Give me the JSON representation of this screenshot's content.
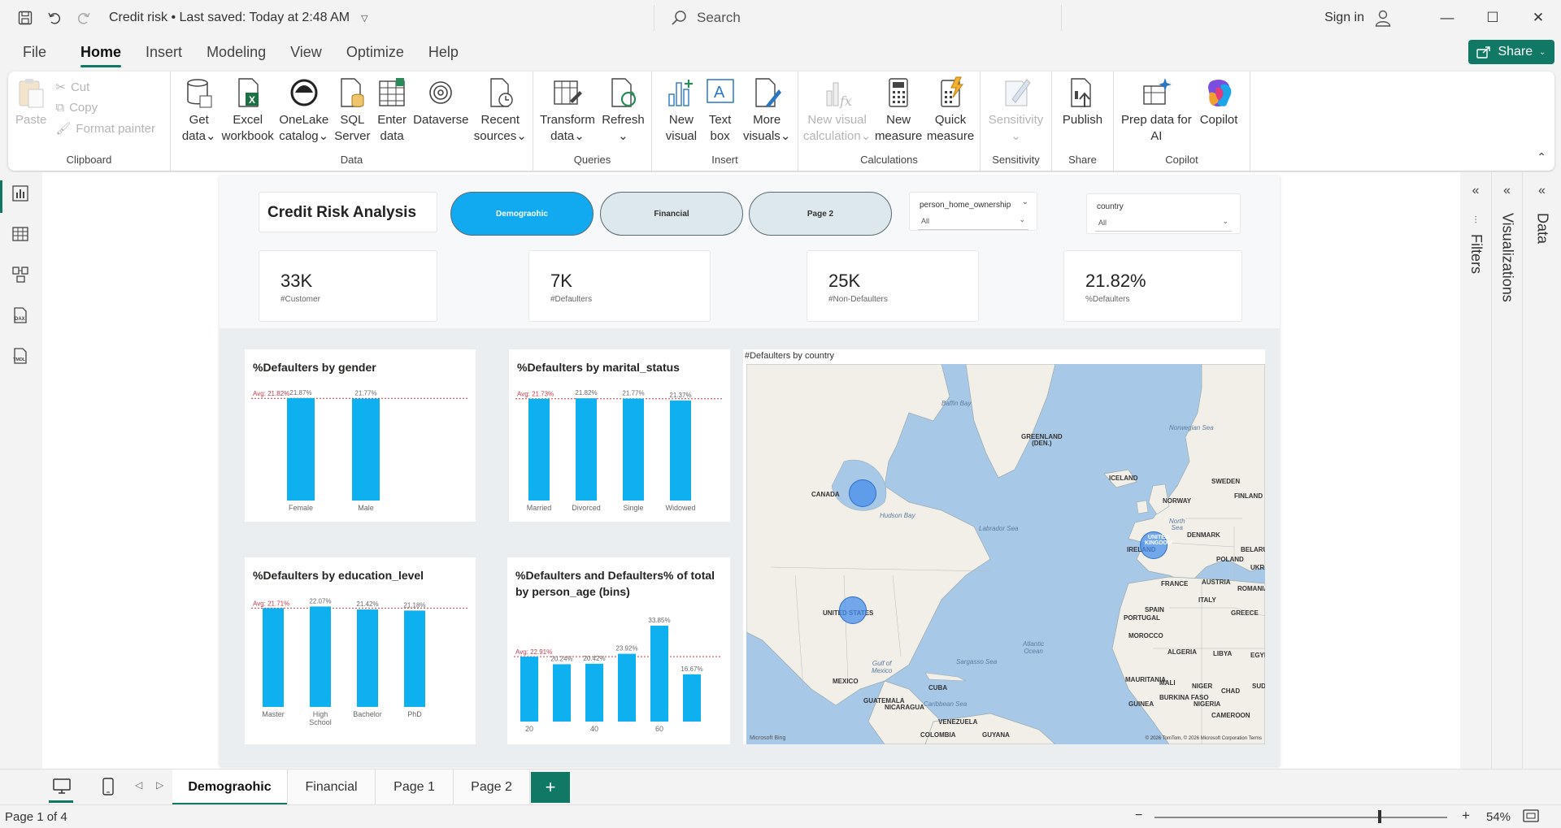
{
  "titlebar": {
    "title": "Credit risk",
    "saved": "Last saved: Today at 2:48 AM",
    "search_placeholder": "Search",
    "signin": "Sign in"
  },
  "menu": {
    "file": "File",
    "home": "Home",
    "insert": "Insert",
    "modeling": "Modeling",
    "view": "View",
    "optimize": "Optimize",
    "help": "Help",
    "share": "Share"
  },
  "ribbon": {
    "clipboard": {
      "paste": "Paste",
      "cut": "Cut",
      "copy": "Copy",
      "format_painter": "Format painter",
      "label": "Clipboard"
    },
    "data": {
      "get_data": [
        "Get",
        "data"
      ],
      "excel": [
        "Excel",
        "workbook"
      ],
      "onelake": [
        "OneLake",
        "catalog"
      ],
      "sql": [
        "SQL",
        "Server"
      ],
      "enter": [
        "Enter",
        "data"
      ],
      "dataverse": [
        "Dataverse",
        ""
      ],
      "recent": [
        "Recent",
        "sources"
      ],
      "label": "Data"
    },
    "queries": {
      "transform": [
        "Transform",
        "data"
      ],
      "refresh": [
        "Refresh",
        ""
      ],
      "label": "Queries"
    },
    "insert": {
      "new_visual": [
        "New",
        "visual"
      ],
      "text_box": [
        "Text",
        "box"
      ],
      "more_visuals": [
        "More",
        "visuals"
      ],
      "label": "Insert"
    },
    "calculations": {
      "new_visual_calc": [
        "New visual",
        "calculation"
      ],
      "new_measure": [
        "New",
        "measure"
      ],
      "quick_measure": [
        "Quick",
        "measure"
      ],
      "label": "Calculations"
    },
    "sensitivity": {
      "btn": [
        "Sensitivity",
        ""
      ],
      "label": "Sensitivity"
    },
    "share": {
      "publish": [
        "Publish",
        ""
      ],
      "label": "Share"
    },
    "copilot": {
      "prep": [
        "Prep data for",
        "AI"
      ],
      "copilot": [
        "Copilot",
        ""
      ],
      "label": "Copilot"
    }
  },
  "report": {
    "title": "Credit Risk Analysis",
    "nav": {
      "demographic": "Demograohic",
      "financial": "Financial",
      "page2": "Page 2"
    },
    "slicer1": {
      "label": "person_home_ownership",
      "value": "All"
    },
    "slicer2": {
      "label": "country",
      "value": "All"
    },
    "kpis": [
      {
        "value": "33K",
        "label": "#Customer"
      },
      {
        "value": "7K",
        "label": "#Defaulters"
      },
      {
        "value": "25K",
        "label": "#Non-Defaulters"
      },
      {
        "value": "21.82%",
        "label": "%Defaulters"
      }
    ],
    "map": {
      "title": "#Defaulters by country",
      "labels": {
        "canada": "CANADA",
        "us": "UNITED STATES",
        "greenland": "GREENLAND\n(DEN.)",
        "iceland": "ICELAND",
        "baffin": "Baffin Bay",
        "hudson": "Hudson Bay",
        "labrador": "Labrador Sea",
        "norwegian": "Norwegian Sea",
        "atlantic": "Atlantic\nOcean",
        "gulf": "Gulf of\nMexico",
        "sargasso": "Sargasso Sea",
        "caribbean": "Caribbean Sea",
        "mexico": "MEXICO",
        "cuba": "CUBA",
        "norway": "NORWAY",
        "sweden": "SWEDEN",
        "finland": "FINLAND",
        "uk": "UNITED\nKINGDOM",
        "ireland": "IRELAND",
        "denmark": "DENMARK",
        "france": "FRANCE",
        "spain": "SPAIN",
        "portugal": "PORTUGAL",
        "morocco": "MOROCCO",
        "algeria": "ALGERIA",
        "libya": "LIBYA",
        "egypt": "EGYPT",
        "mali": "MALI",
        "niger": "NIGER",
        "chad": "CHAD",
        "mauritania": "MAURITANIA",
        "nigeria": "NIGERIA",
        "poland": "POLAND",
        "belarus": "BELARUS",
        "ukraine": "UKRAI",
        "romania": "ROMANIA",
        "austria": "AUSTRIA",
        "italy": "ITALY",
        "greece": "GREECE",
        "north_sea": "North\nSea",
        "venezuela": "VENEZUELA",
        "colombia": "COLOMBIA",
        "guatemala": "GUATEMALA",
        "nicaragua": "NICARAGUA",
        "burkina": "BURKINA FASO",
        "guinea": "GUINEA",
        "cameroon": "CAMEROON",
        "guyana": "GUYANA",
        "sudan": "SUDA",
        "copyright": "© 2026 TomTom, © 2026 Microsoft Corporation  Terms",
        "bing": "Microsoft Bing"
      }
    }
  },
  "chart_data": [
    {
      "type": "bar",
      "title": "%Defaulters by gender",
      "categories": [
        "Female",
        "Male"
      ],
      "values": [
        21.87,
        21.77
      ],
      "value_labels": [
        "21.87%",
        "21.77%"
      ],
      "avg_label": "Avg: 21.82%",
      "avg": 21.82,
      "color": "#0fb0ef"
    },
    {
      "type": "bar",
      "title": "%Defaulters by marital_status",
      "categories": [
        "Married",
        "Divorced",
        "Single",
        "Widowed"
      ],
      "values": [
        21.73,
        21.82,
        21.77,
        21.37
      ],
      "value_labels": [
        "",
        "21.82%",
        "21.77%",
        "21.37%"
      ],
      "avg_label": "Avg: 21.73%",
      "avg": 21.73,
      "color": "#0fb0ef"
    },
    {
      "type": "bar",
      "title": "%Defaulters by education_level",
      "categories": [
        "Master",
        "High\nSchool",
        "Bachelor",
        "PhD"
      ],
      "values": [
        21.71,
        22.07,
        21.42,
        21.18
      ],
      "value_labels": [
        "",
        "22.07%",
        "21.42%",
        "21.18%"
      ],
      "avg_label": "Avg: 21.71%",
      "avg": 21.71,
      "color": "#0fb0ef"
    },
    {
      "type": "bar",
      "title": "%Defaulters and Defaulters% of total by person_age (bins)",
      "x_ticks": [
        "20",
        "40",
        "60"
      ],
      "values": [
        22.91,
        20.24,
        20.42,
        23.92,
        33.85,
        16.67
      ],
      "value_labels": [
        "",
        "20.24%",
        "20.42%",
        "23.92%",
        "33.85%",
        "16.67%"
      ],
      "avg_label": "Avg: 22.91%",
      "avg": 22.91,
      "color": "#0fb0ef"
    }
  ],
  "tabs": [
    "Demograohic",
    "Financial",
    "Page 1",
    "Page 2"
  ],
  "panes": {
    "filters": "Filters",
    "visualizations": "Visualizations",
    "data": "Data"
  },
  "status": {
    "page": "Page 1 of 4",
    "zoom": "54%"
  }
}
